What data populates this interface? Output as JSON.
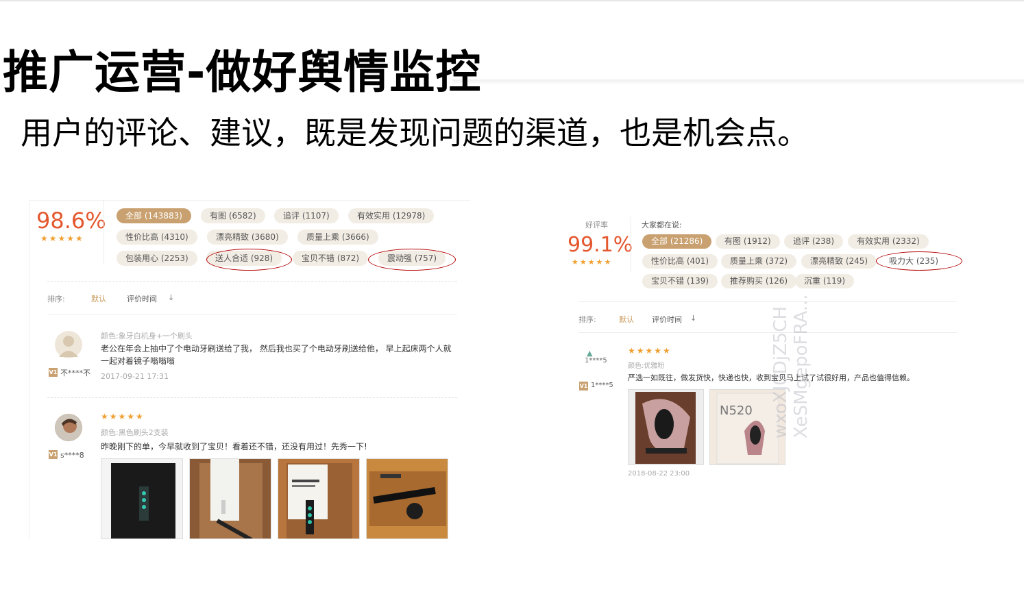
{
  "slide": {
    "title": "推广运营-做好舆情监控",
    "subtitle": "用户的评论、建议，既是发现问题的渠道，也是机会点。"
  },
  "left_panel": {
    "rate": "98.6%",
    "stars": "★★★★★",
    "tags": [
      {
        "label": "全部 (143883)",
        "active": true
      },
      {
        "label": "有图 (6582)"
      },
      {
        "label": "追评 (1107)"
      },
      {
        "label": "有效实用 (12978)"
      },
      {
        "label": "性价比高 (4310)"
      },
      {
        "label": "漂亮精致 (3680)"
      },
      {
        "label": "质量上乘 (3666)"
      },
      {
        "label": "包装用心 (2253)"
      },
      {
        "label": "送人合适 (928)",
        "circled": true
      },
      {
        "label": "宝贝不错 (872)"
      },
      {
        "label": "震动强 (757)",
        "circled": true
      }
    ],
    "sort_label": "排序:",
    "sort_default": "默认",
    "sort_time": "评价时间",
    "sort_arrow": "↓",
    "reviews": [
      {
        "spec": "颜色:象牙白机身+一个刷头",
        "text": "老公在年会上抽中了个电动牙刷送给了我， 然后我也买了个电动牙刷送给他， 早上起床两个人就一起对着镜子嗡嗡嗡",
        "date": "2017-09-21 17:31",
        "user": "不****不",
        "badge": "V1"
      },
      {
        "stars": "★★★★★",
        "spec": "颜色:黑色刷头2支装",
        "text": "昨晚刚下的单，今早就收到了宝贝！看着还不错，还没有用过！先秀一下!",
        "user": "s****8",
        "badge": "V1"
      }
    ]
  },
  "right_panel": {
    "rate_label": "好评率",
    "rate": "99.1%",
    "stars": "★★★★★",
    "everyone_says": "大家都在说:",
    "tags": [
      {
        "label": "全部 (21286)",
        "active": true
      },
      {
        "label": "有图 (1912)"
      },
      {
        "label": "追评 (238)"
      },
      {
        "label": "有效实用 (2332)"
      },
      {
        "label": "性价比高 (401)"
      },
      {
        "label": "质量上乘 (372)"
      },
      {
        "label": "漂亮精致 (245)"
      },
      {
        "label": "吸力大 (235)",
        "circled": true
      },
      {
        "label": "宝贝不错 (139)"
      },
      {
        "label": "推荐购买 (126)"
      },
      {
        "label": "沉重 (119)"
      }
    ],
    "sort_label": "排序:",
    "sort_default": "默认",
    "sort_time": "评价时间",
    "sort_arrow": "↓",
    "review": {
      "avatar_name": "1****5",
      "stars": "★★★★★",
      "spec": "颜色:优雅粉",
      "text": "严选一如既往，做发货快，快递也快，收到宝贝马上试了试很好用，产品也值得信赖。",
      "date": "2018-08-22 23:00",
      "user": "1****5",
      "badge": "V1",
      "photo_text": "N520"
    },
    "watermark_1": "wxoXJ0DjZ5CH",
    "watermark_2": "XeSMgepoFRA..."
  }
}
